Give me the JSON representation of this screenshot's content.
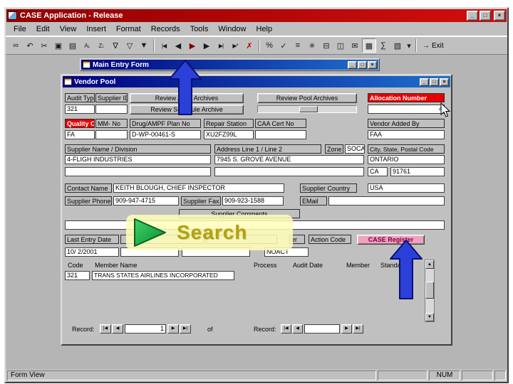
{
  "app": {
    "title": "CASE Application - Release",
    "menu_items": [
      "File",
      "Edit",
      "View",
      "Insert",
      "Format",
      "Records",
      "Tools",
      "Window",
      "Help"
    ],
    "window_buttons": {
      "minimize": "_",
      "maximize": "□",
      "close": "×"
    },
    "toolbar": {
      "exit_label": "Exit",
      "exit_glyph": "→",
      "icons": [
        {
          "name": "find",
          "glyph": "∞"
        },
        {
          "name": "undo",
          "glyph": "↶"
        },
        {
          "name": "cut",
          "glyph": "✂"
        },
        {
          "name": "copy",
          "glyph": "▣"
        },
        {
          "name": "paste",
          "glyph": "▤"
        },
        {
          "name": "sort-ascending",
          "glyph": "A↓"
        },
        {
          "name": "sort-descending",
          "glyph": "Z↓"
        },
        {
          "name": "filter-by-selection",
          "glyph": "∇"
        },
        {
          "name": "filter-by-form",
          "glyph": "▽"
        },
        {
          "name": "apply-filter",
          "glyph": "▼"
        },
        {
          "name": "first-record",
          "glyph": "|◀"
        },
        {
          "name": "previous-record",
          "glyph": "◀"
        },
        {
          "name": "play",
          "glyph": "▶"
        },
        {
          "name": "next-record",
          "glyph": "▶"
        },
        {
          "name": "last-record",
          "glyph": "▶|"
        },
        {
          "name": "new-record",
          "glyph": "▶*"
        },
        {
          "name": "delete-record",
          "glyph": "✗"
        },
        {
          "name": "percent",
          "glyph": "%"
        },
        {
          "name": "spelling",
          "glyph": "✓"
        },
        {
          "name": "properties",
          "glyph": "≡"
        },
        {
          "name": "build",
          "glyph": "✳"
        },
        {
          "name": "print",
          "glyph": "⊟"
        },
        {
          "name": "print-preview",
          "glyph": "◫"
        },
        {
          "name": "mail",
          "glyph": "✉"
        },
        {
          "name": "database-window",
          "glyph": "▦"
        },
        {
          "name": "analyze",
          "glyph": "∑"
        },
        {
          "name": "new-object",
          "glyph": "▧"
        },
        {
          "name": "new-object-dropdown",
          "glyph": "▾"
        }
      ]
    },
    "status": {
      "mode": "Form View",
      "num": "NUM"
    }
  },
  "main_entry_form": {
    "title": "Main Entry Form"
  },
  "vendor_pool": {
    "title": "Vendor Pool",
    "buttons": {
      "review_audit": "Review Audit Archives",
      "review_pool": "Review Pool Archives",
      "review_schedule": "Review Schedule Archive",
      "case_register": "CASE Register"
    },
    "fields": {
      "audit_type": {
        "label": "Audit Type",
        "value": "321"
      },
      "supplier_id": {
        "label": "Supplier ID",
        "value": ""
      },
      "allocation_number": {
        "label": "Allocation Number",
        "value": "4"
      },
      "quality_cd": {
        "label": "Quality Cd",
        "value": "FA"
      },
      "mm_no": {
        "label": "MM- No",
        "value": ""
      },
      "drug_ampf_plan_no": {
        "label": "Drug/AMPF Plan No",
        "value": "D-WP-00461-S"
      },
      "repair_station": {
        "label": "Repair Station",
        "value": "XU2FZ99L"
      },
      "caa_cert_no": {
        "label": "CAA Cert No",
        "value": ""
      },
      "vendor_added_by": {
        "label": "Vendor Added By",
        "value": "FAA"
      },
      "supplier_name": {
        "label": "Supplier Name / Division",
        "value": "4-FLIGH INDUSTRIES",
        "value2": ""
      },
      "address": {
        "label": "Address Line 1 / Line 2",
        "value": "7945 S. GROVE AVENUE",
        "value2": ""
      },
      "zone": {
        "label": "Zone",
        "value": "SOCA"
      },
      "city_state_postal": {
        "label": "City, State, Postal Code",
        "city": "ONTARIO",
        "state": "CA",
        "postal": "91761"
      },
      "contact_name": {
        "label": "Contact Name",
        "value": "KEITH BLOUGH, CHIEF INSPECTOR"
      },
      "supplier_country": {
        "label": "Supplier Country",
        "value": "USA"
      },
      "supplier_phone": {
        "label": "Supplier Phone",
        "value": "909-947-4715"
      },
      "supplier_fax": {
        "label": "Supplier Fax",
        "value": "909-923-1588"
      },
      "email": {
        "label": "EMail",
        "value": ""
      },
      "supplier_comments": {
        "label": "Supplier Comments",
        "value": ""
      },
      "last_entry_date": {
        "label": "Last Entry Date",
        "value": "10/ 2/2001"
      },
      "partial_label": "er",
      "action_code": {
        "label": "Action Code",
        "value": "NOACT"
      }
    },
    "member_table": {
      "headers": [
        "Code",
        "Member Name"
      ],
      "rows": [
        {
          "code": "321",
          "member_name": "TRANS STATES AIRLINES INCORPORATED"
        }
      ]
    },
    "audit_table": {
      "headers": [
        "Process",
        "Audit Date",
        "Member",
        "Standa"
      ]
    },
    "record_nav": {
      "label": "Record:",
      "value": "1",
      "of_label": "of"
    },
    "record_nav_right": {
      "label": "Record:",
      "value": ""
    }
  },
  "annotations": {
    "search_label": "Search"
  }
}
